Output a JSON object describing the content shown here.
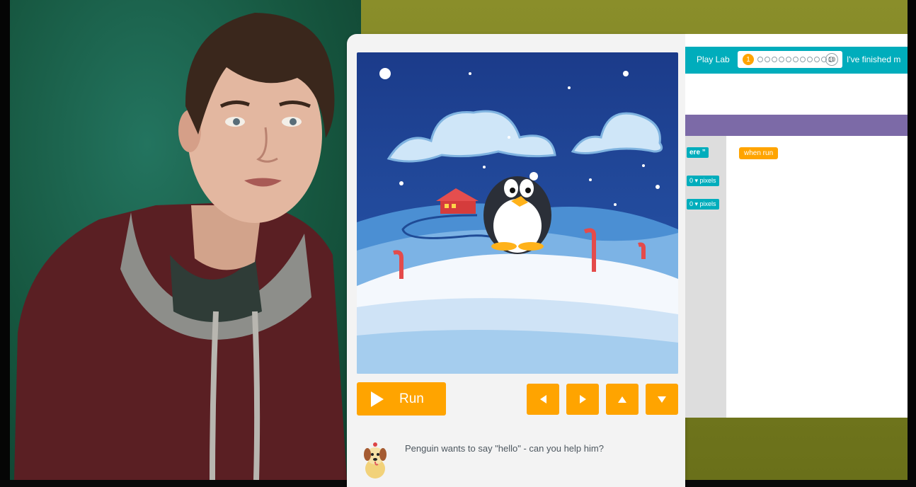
{
  "app": {
    "title": "Play Lab",
    "progress": {
      "current": "1",
      "total": "10"
    },
    "finished_text": "I've finished m",
    "run_label": "Run",
    "instruction": "Penguin wants to say \"hello\" - can you help him?",
    "controls": [
      "left-arrow",
      "right-arrow",
      "up-arrow",
      "down-arrow"
    ],
    "blocks": {
      "say_fragment": "ere ”",
      "pixels_1": "pixels",
      "pixels_1_prefix": "0 ▾",
      "pixels_2": "pixels",
      "pixels_2_prefix": "0 ▾",
      "when_run": "when run"
    }
  },
  "colors": {
    "accent": "#ffa400",
    "teal": "#00adbc",
    "purple": "#7c6aa7",
    "sky": "#1b3b8a",
    "snow": "#eef4fb"
  }
}
